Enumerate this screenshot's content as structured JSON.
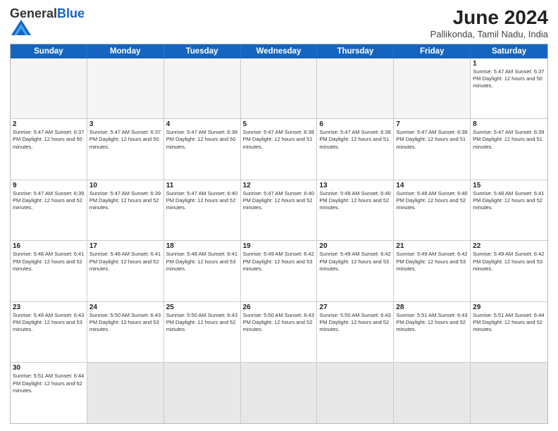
{
  "header": {
    "logo_general": "General",
    "logo_blue": "Blue",
    "title": "June 2024",
    "subtitle": "Pallikonda, Tamil Nadu, India"
  },
  "weekdays": [
    "Sunday",
    "Monday",
    "Tuesday",
    "Wednesday",
    "Thursday",
    "Friday",
    "Saturday"
  ],
  "rows": [
    [
      {
        "day": "",
        "info": "",
        "empty": true
      },
      {
        "day": "",
        "info": "",
        "empty": true
      },
      {
        "day": "",
        "info": "",
        "empty": true
      },
      {
        "day": "",
        "info": "",
        "empty": true
      },
      {
        "day": "",
        "info": "",
        "empty": true
      },
      {
        "day": "",
        "info": "",
        "empty": true
      },
      {
        "day": "1",
        "info": "Sunrise: 5:47 AM\nSunset: 6:37 PM\nDaylight: 12 hours\nand 50 minutes."
      }
    ],
    [
      {
        "day": "2",
        "info": "Sunrise: 5:47 AM\nSunset: 6:37 PM\nDaylight: 12 hours\nand 50 minutes."
      },
      {
        "day": "3",
        "info": "Sunrise: 5:47 AM\nSunset: 6:37 PM\nDaylight: 12 hours\nand 50 minutes."
      },
      {
        "day": "4",
        "info": "Sunrise: 5:47 AM\nSunset: 6:38 PM\nDaylight: 12 hours\nand 50 minutes."
      },
      {
        "day": "5",
        "info": "Sunrise: 5:47 AM\nSunset: 6:38 PM\nDaylight: 12 hours\nand 51 minutes."
      },
      {
        "day": "6",
        "info": "Sunrise: 5:47 AM\nSunset: 6:38 PM\nDaylight: 12 hours\nand 51 minutes."
      },
      {
        "day": "7",
        "info": "Sunrise: 5:47 AM\nSunset: 6:38 PM\nDaylight: 12 hours\nand 51 minutes."
      },
      {
        "day": "8",
        "info": "Sunrise: 5:47 AM\nSunset: 6:39 PM\nDaylight: 12 hours\nand 51 minutes."
      }
    ],
    [
      {
        "day": "9",
        "info": "Sunrise: 5:47 AM\nSunset: 6:39 PM\nDaylight: 12 hours\nand 52 minutes."
      },
      {
        "day": "10",
        "info": "Sunrise: 5:47 AM\nSunset: 6:39 PM\nDaylight: 12 hours\nand 52 minutes."
      },
      {
        "day": "11",
        "info": "Sunrise: 5:47 AM\nSunset: 6:40 PM\nDaylight: 12 hours\nand 52 minutes."
      },
      {
        "day": "12",
        "info": "Sunrise: 5:47 AM\nSunset: 6:40 PM\nDaylight: 12 hours\nand 52 minutes."
      },
      {
        "day": "13",
        "info": "Sunrise: 5:48 AM\nSunset: 6:40 PM\nDaylight: 12 hours\nand 52 minutes."
      },
      {
        "day": "14",
        "info": "Sunrise: 5:48 AM\nSunset: 6:40 PM\nDaylight: 12 hours\nand 52 minutes."
      },
      {
        "day": "15",
        "info": "Sunrise: 5:48 AM\nSunset: 6:41 PM\nDaylight: 12 hours\nand 52 minutes."
      }
    ],
    [
      {
        "day": "16",
        "info": "Sunrise: 5:48 AM\nSunset: 6:41 PM\nDaylight: 12 hours\nand 52 minutes."
      },
      {
        "day": "17",
        "info": "Sunrise: 5:48 AM\nSunset: 6:41 PM\nDaylight: 12 hours\nand 52 minutes."
      },
      {
        "day": "18",
        "info": "Sunrise: 5:48 AM\nSunset: 6:41 PM\nDaylight: 12 hours\nand 53 minutes."
      },
      {
        "day": "19",
        "info": "Sunrise: 5:49 AM\nSunset: 6:42 PM\nDaylight: 12 hours\nand 53 minutes."
      },
      {
        "day": "20",
        "info": "Sunrise: 5:49 AM\nSunset: 6:42 PM\nDaylight: 12 hours\nand 53 minutes."
      },
      {
        "day": "21",
        "info": "Sunrise: 5:49 AM\nSunset: 6:42 PM\nDaylight: 12 hours\nand 53 minutes."
      },
      {
        "day": "22",
        "info": "Sunrise: 5:49 AM\nSunset: 6:42 PM\nDaylight: 12 hours\nand 53 minutes."
      }
    ],
    [
      {
        "day": "23",
        "info": "Sunrise: 5:49 AM\nSunset: 6:43 PM\nDaylight: 12 hours\nand 53 minutes."
      },
      {
        "day": "24",
        "info": "Sunrise: 5:50 AM\nSunset: 6:43 PM\nDaylight: 12 hours\nand 53 minutes."
      },
      {
        "day": "25",
        "info": "Sunrise: 5:50 AM\nSunset: 6:43 PM\nDaylight: 12 hours\nand 52 minutes."
      },
      {
        "day": "26",
        "info": "Sunrise: 5:50 AM\nSunset: 6:43 PM\nDaylight: 12 hours\nand 52 minutes."
      },
      {
        "day": "27",
        "info": "Sunrise: 5:50 AM\nSunset: 6:43 PM\nDaylight: 12 hours\nand 52 minutes."
      },
      {
        "day": "28",
        "info": "Sunrise: 5:51 AM\nSunset: 6:43 PM\nDaylight: 12 hours\nand 52 minutes."
      },
      {
        "day": "29",
        "info": "Sunrise: 5:51 AM\nSunset: 6:44 PM\nDaylight: 12 hours\nand 52 minutes."
      }
    ],
    [
      {
        "day": "30",
        "info": "Sunrise: 5:51 AM\nSunset: 6:44 PM\nDaylight: 12 hours\nand 52 minutes."
      },
      {
        "day": "",
        "info": "",
        "empty": true,
        "shaded": true
      },
      {
        "day": "",
        "info": "",
        "empty": true,
        "shaded": true
      },
      {
        "day": "",
        "info": "",
        "empty": true,
        "shaded": true
      },
      {
        "day": "",
        "info": "",
        "empty": true,
        "shaded": true
      },
      {
        "day": "",
        "info": "",
        "empty": true,
        "shaded": true
      },
      {
        "day": "",
        "info": "",
        "empty": true,
        "shaded": true
      }
    ]
  ]
}
